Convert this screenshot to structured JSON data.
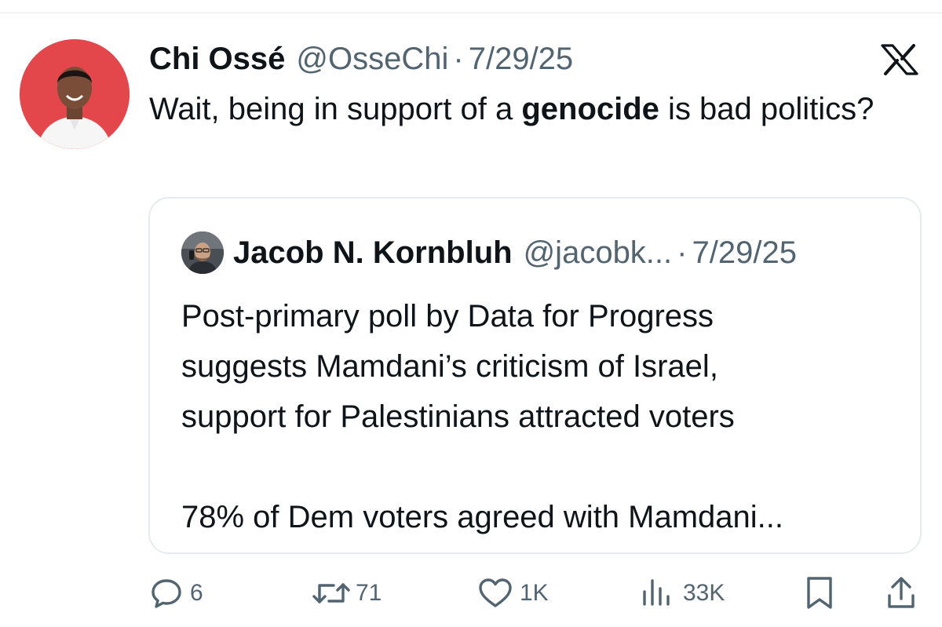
{
  "tweet": {
    "author_name": "Chi Ossé",
    "author_handle": "@OsseChi",
    "separator": "·",
    "date": "7/29/25",
    "text_before": "Wait, being in support of a ",
    "text_bold": "genocide",
    "text_after": " is bad politics?"
  },
  "quote": {
    "author_name": "Jacob N. Kornbluh",
    "author_handle": "@jacobk...",
    "separator": "·",
    "date": "7/29/25",
    "lines": [
      "Post-primary poll by Data for Progress",
      "suggests Mamdani’s criticism of Israel,",
      "support for Palestinians attracted voters"
    ],
    "extra_line": "78% of Dem voters agreed with Mamdani..."
  },
  "actions": {
    "replies": "6",
    "reposts": "71",
    "likes": "1K",
    "views": "33K"
  },
  "icons": {
    "platform": "x-logo-icon",
    "reply": "reply-bubble-icon",
    "repost": "repost-arrows-icon",
    "like": "heart-icon",
    "views": "views-bars-icon",
    "bookmark": "bookmark-icon",
    "share": "share-upload-icon"
  },
  "colors": {
    "text_primary": "#0f1419",
    "text_secondary": "#536471",
    "icon_gray": "#536471",
    "avatar_background": "#e3474b",
    "card_border": "#e8ebee"
  }
}
